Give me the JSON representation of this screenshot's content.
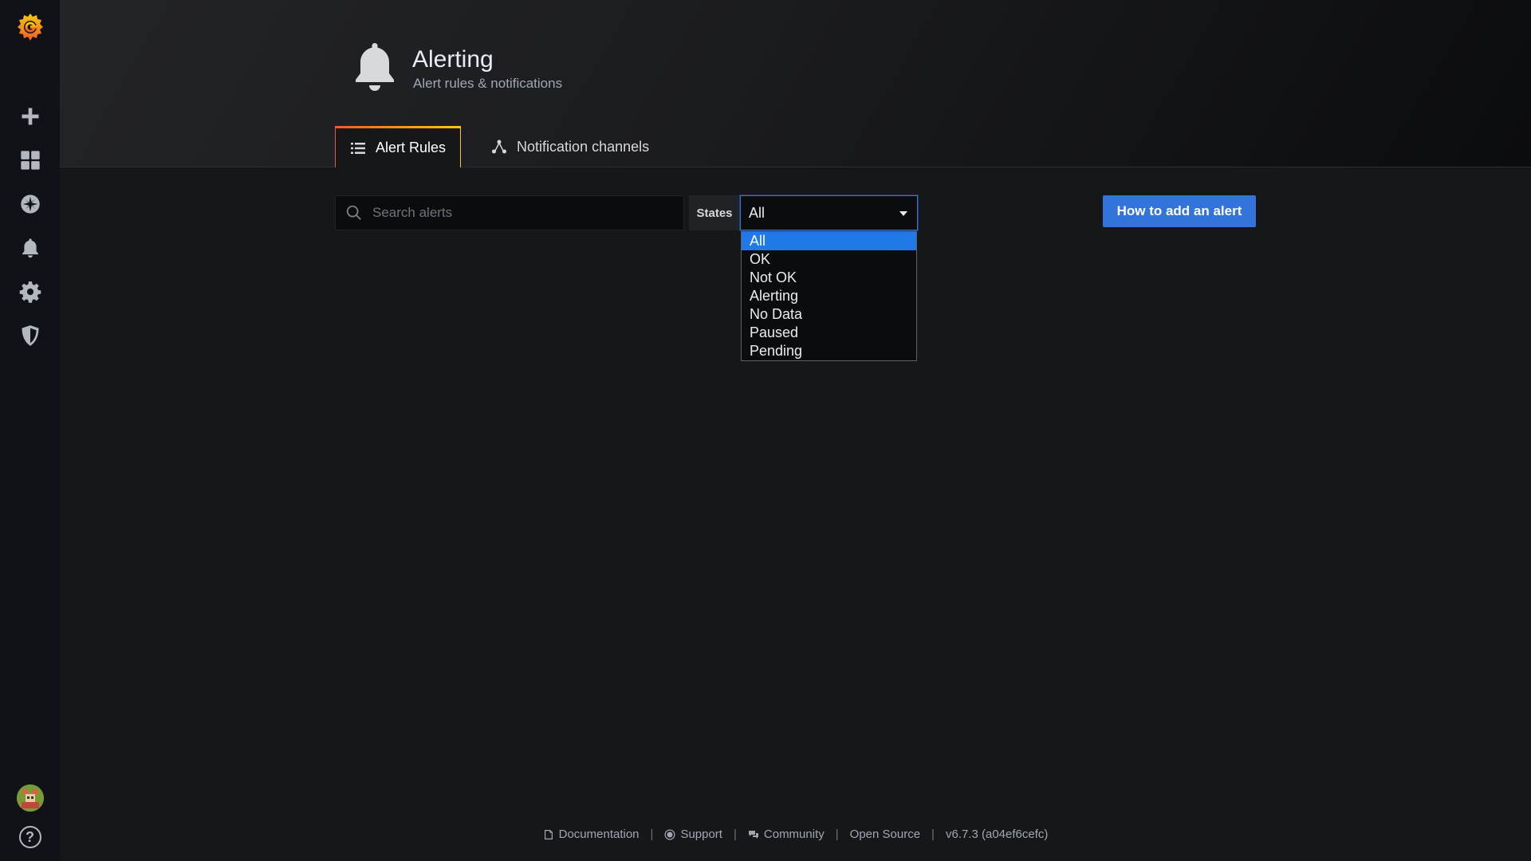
{
  "sidebar": {
    "logo": "grafana-logo",
    "items": [
      {
        "name": "create",
        "icon": "plus-icon"
      },
      {
        "name": "dashboards",
        "icon": "grid-icon"
      },
      {
        "name": "explore",
        "icon": "compass-icon"
      },
      {
        "name": "alerting",
        "icon": "bell-icon"
      },
      {
        "name": "configuration",
        "icon": "gear-icon"
      },
      {
        "name": "server-admin",
        "icon": "shield-icon"
      }
    ],
    "help_glyph": "?"
  },
  "header": {
    "title": "Alerting",
    "subtitle": "Alert rules & notifications"
  },
  "tabs": [
    {
      "label": "Alert Rules",
      "icon": "list-icon",
      "active": true
    },
    {
      "label": "Notification channels",
      "icon": "share-nodes-icon",
      "active": false
    }
  ],
  "toolbar": {
    "search_placeholder": "Search alerts",
    "states_label": "States",
    "states_selected": "All",
    "states_options": [
      "All",
      "OK",
      "Not OK",
      "Alerting",
      "No Data",
      "Paused",
      "Pending"
    ],
    "add_alert_button": "How to add an alert"
  },
  "footer": {
    "documentation": "Documentation",
    "support": "Support",
    "community": "Community",
    "open_source": "Open Source",
    "version": "v6.7.3 (a04ef6cefc)",
    "separator": "|"
  },
  "colors": {
    "accent": "#3274d9",
    "selected_option": "#1f7ae8",
    "background": "#161719",
    "sidebar": "#111217"
  }
}
